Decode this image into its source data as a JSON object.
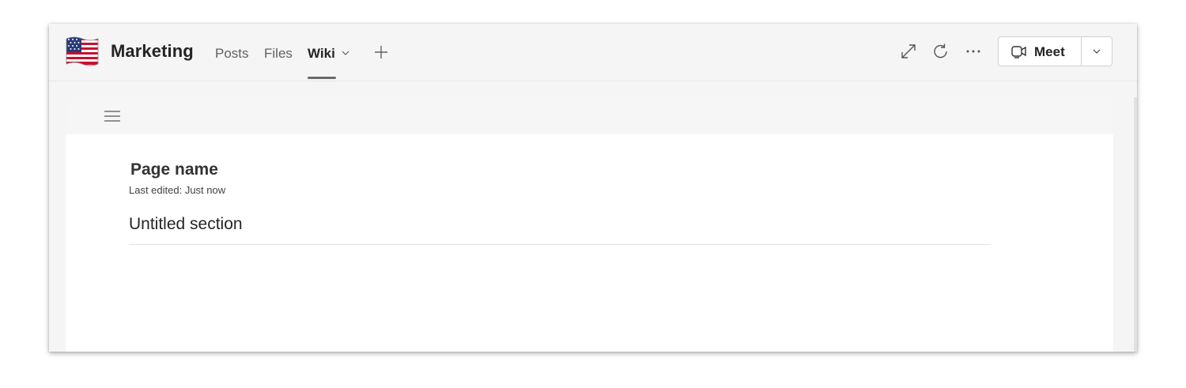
{
  "header": {
    "team_name": "Marketing",
    "tabs": [
      {
        "label": "Posts",
        "active": false
      },
      {
        "label": "Files",
        "active": false
      },
      {
        "label": "Wiki",
        "active": true
      }
    ],
    "icons": [
      "expand-icon",
      "refresh-icon",
      "more-options-icon",
      "add-tab-icon"
    ],
    "meet": {
      "label": "Meet",
      "icon": "video-camera-icon"
    }
  },
  "wiki": {
    "page_title": "Page name",
    "last_edited": "Last edited: Just now",
    "section_title": "Untitled section"
  },
  "colors": {
    "header_bg": "#f5f5f5",
    "content_bg": "#ffffff",
    "toolbar_bg": "#f7f6f6",
    "active_tab_underline": "#6b6b6b"
  }
}
